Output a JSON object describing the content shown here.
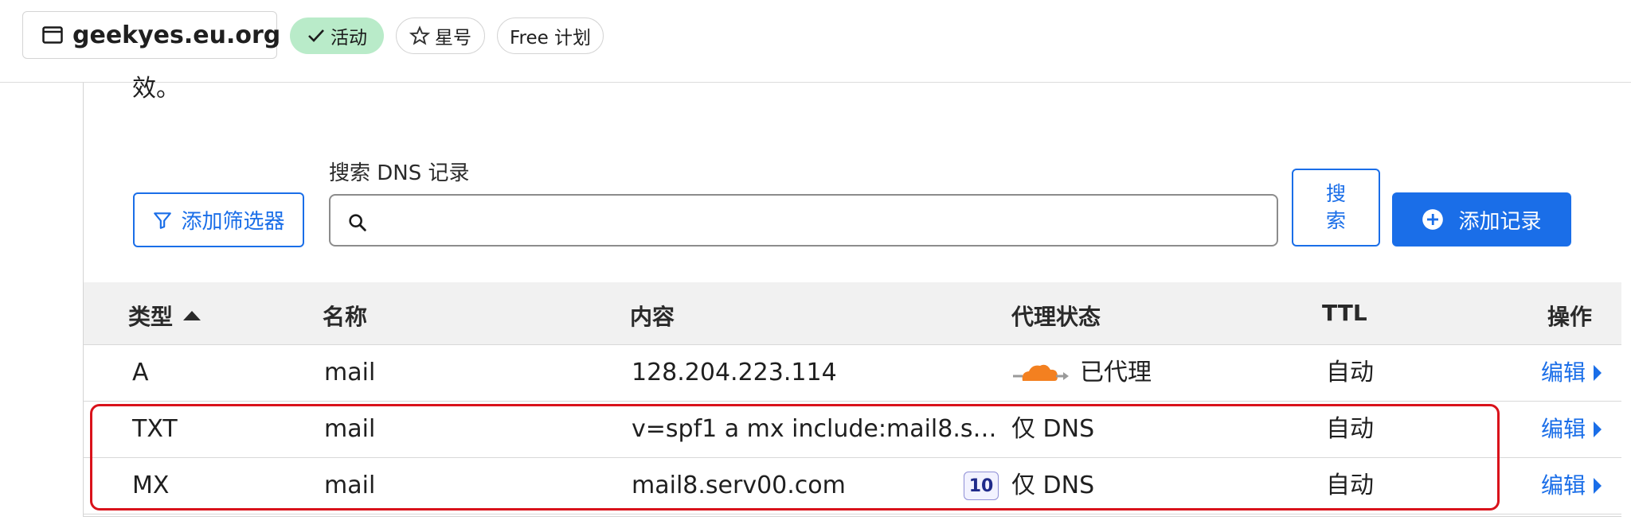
{
  "topbar": {
    "domain": "geekyes.eu.org",
    "status_label": "活动",
    "star_label": "星号",
    "plan_label": "Free 计划"
  },
  "panel": {
    "cut_text": "效。",
    "search_label": "搜索 DNS 记录",
    "search_value": "",
    "filter_button": "添加筛选器",
    "search_button": "搜索",
    "add_record_button": "添加记录"
  },
  "table": {
    "headers": {
      "type": "类型",
      "name": "名称",
      "content": "内容",
      "proxy": "代理状态",
      "ttl": "TTL",
      "actions": "操作"
    },
    "sort": {
      "column": "type",
      "direction": "ascending"
    },
    "rows": [
      {
        "type": "A",
        "name": "mail",
        "content": "128.204.223.114",
        "priority": "",
        "proxy": "已代理",
        "proxy_icon": "cloud-proxied-icon",
        "ttl": "自动",
        "edit": "编辑"
      },
      {
        "type": "TXT",
        "name": "mail",
        "content": "v=spf1 a mx include:mail8.se...",
        "priority": "",
        "proxy": "仅 DNS",
        "proxy_icon": "",
        "ttl": "自动",
        "edit": "编辑"
      },
      {
        "type": "MX",
        "name": "mail",
        "content": "mail8.serv00.com",
        "priority": "10",
        "proxy": "仅 DNS",
        "proxy_icon": "",
        "ttl": "自动",
        "edit": "编辑"
      }
    ]
  },
  "colors": {
    "accent": "#1a6ee8",
    "active_pill": "#b9ebc9",
    "highlight": "#d9121b",
    "cloud": "#f38020"
  }
}
